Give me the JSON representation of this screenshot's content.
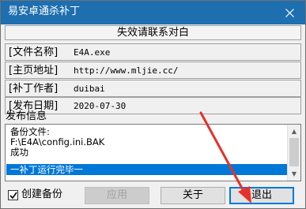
{
  "window": {
    "title": "易安卓通杀补丁"
  },
  "banner": {
    "text": "失效请联系对白"
  },
  "info_rows": [
    {
      "label": "[文件名称]",
      "value": "E4A.exe"
    },
    {
      "label": "[主页地址]",
      "value": "http://www.mljie.cc/"
    },
    {
      "label": "[补丁作者]",
      "value": "duibai"
    },
    {
      "label": "[发布日期]",
      "value": "2020-07-30"
    }
  ],
  "log": {
    "title": "发布信息",
    "lines": [
      "备份文件:",
      "F:\\E4A\\config.ini.BAK",
      "成功"
    ],
    "selected_line": "一补丁运行完毕一"
  },
  "footer": {
    "checkbox_label": "创建备份",
    "checkbox_checked": true,
    "apply_label": "应用",
    "about_label": "关于",
    "exit_label": "退出"
  },
  "colors": {
    "titlebar": "#1e6fb0",
    "selection": "#0078d7",
    "annotation_arrow": "#e8302a"
  },
  "icons": {
    "close": "close-icon",
    "check": "check-icon",
    "scroll_up": "scroll-up-arrow-icon",
    "scroll_down": "scroll-down-arrow-icon"
  }
}
